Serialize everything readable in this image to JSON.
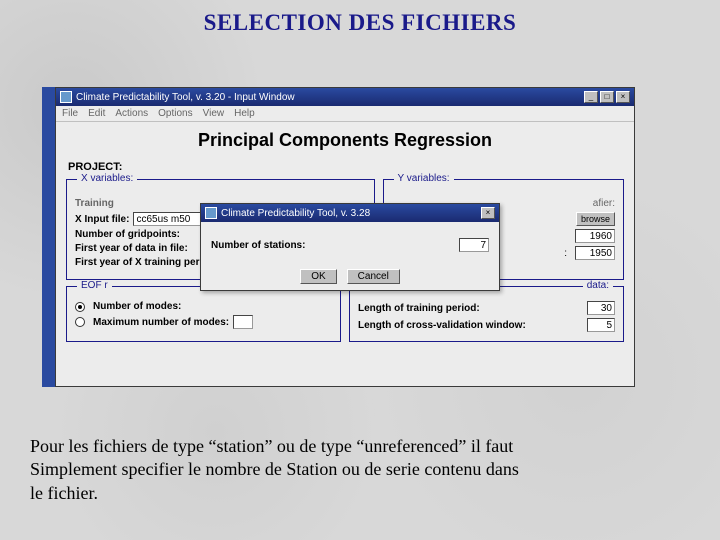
{
  "slide": {
    "title": "SELECTION DES FICHIERS",
    "caption_line1": "Pour les fichiers de type “station” ou de type “unreferenced” il faut",
    "caption_line2": "Simplement specifier le nombre de Station ou de serie contenu dans",
    "caption_line3": "le fichier."
  },
  "main_window": {
    "title": "Climate Predictability Tool, v. 3.20 - Input Window",
    "menu": {
      "file": "File",
      "edit": "Edit",
      "actions": "Actions",
      "options": "Options",
      "view": "View",
      "help": "Help"
    },
    "heading": "Principal Components Regression",
    "project_label": "PROJECT:",
    "xvars": {
      "legend": "X variables:",
      "training_label": "Training",
      "xinput_label": "X Input file:",
      "xinput_value": "cc65us m50",
      "n_grid_label": "Number of gridpoints:",
      "first_year_file_label": "First year of data in file:",
      "first_year_train_label": "First year of X training per"
    },
    "yvars": {
      "legend": "Y variables:",
      "afier_label": "afier:",
      "browse_label": "browse",
      "year_a": "1960",
      "year_b": "1950"
    },
    "eof": {
      "legend": "EOF r",
      "num_modes_label": "Number of modes:",
      "max_modes_label": "Maximum number of modes:"
    },
    "right_lower": {
      "legend": "data:",
      "len_train_label": "Length of training period:",
      "len_train_val": "30",
      "cv_label": "Length of cross-validation window:",
      "cv_val": "5"
    }
  },
  "dialog": {
    "title": "Climate Predictability Tool, v. 3.28",
    "n_stations_label": "Number of stations:",
    "n_stations_val": "7",
    "ok_label": "OK",
    "cancel_label": "Cancel"
  }
}
